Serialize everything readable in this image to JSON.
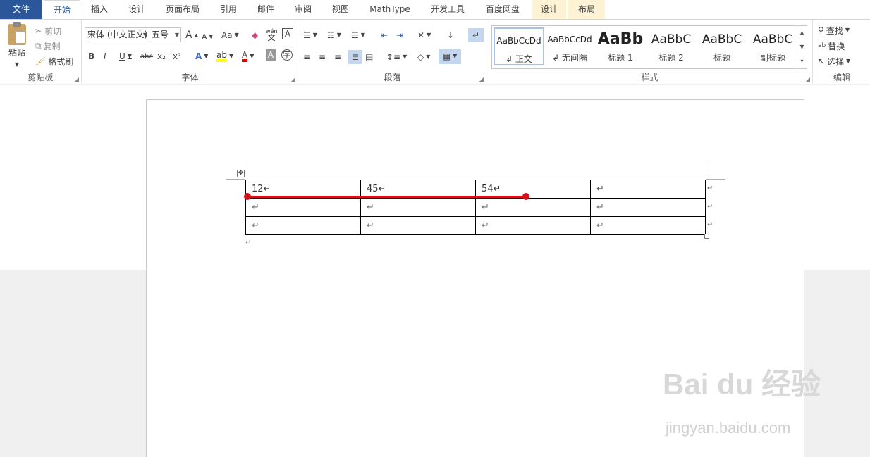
{
  "tabs": [
    "文件",
    "开始",
    "插入",
    "设计",
    "页面布局",
    "引用",
    "邮件",
    "审阅",
    "视图",
    "MathType",
    "开发工具",
    "百度网盘",
    "设计",
    "布局"
  ],
  "clipboard": {
    "paste": "粘贴",
    "cut": "剪切",
    "copy": "复制",
    "format_painter": "格式刷",
    "group_label": "剪贴板"
  },
  "font": {
    "font_name": "宋体 (中文正文)",
    "font_size": "五号",
    "group_label": "字体",
    "bold": "B",
    "italic": "I",
    "underline": "U",
    "strike": "abc",
    "subscript": "x₂",
    "superscript": "x²",
    "grow": "A",
    "shrink": "A",
    "case": "Aa",
    "phonetic_top": "wén",
    "phonetic_bottom": "文"
  },
  "paragraph": {
    "group_label": "段落"
  },
  "styles": {
    "group_label": "样式",
    "items": [
      {
        "sample": "AaBbCcDd",
        "name": "↲ 正文"
      },
      {
        "sample": "AaBbCcDd",
        "name": "↲ 无间隔"
      },
      {
        "sample": "AaBb",
        "name": "标题 1"
      },
      {
        "sample": "AaBbC",
        "name": "标题 2"
      },
      {
        "sample": "AaBbC",
        "name": "标题"
      },
      {
        "sample": "AaBbC",
        "name": "副标题"
      }
    ]
  },
  "editing": {
    "group_label": "编辑",
    "find": "查找",
    "replace": "替换",
    "select": "选择"
  },
  "table": {
    "rows": [
      [
        "12↵",
        "45↵",
        "54↵",
        "↵"
      ],
      [
        "↵",
        "↵",
        "↵",
        "↵"
      ],
      [
        "↵",
        "↵",
        "↵",
        "↵"
      ]
    ],
    "row_end_mark": "↵",
    "after_table_mark": "↵"
  },
  "colors": {
    "accent": "#2b579a",
    "annotation": "#d0121b"
  },
  "watermark": {
    "brand": "Bai du 经验",
    "url": "jingyan.baidu.com"
  }
}
